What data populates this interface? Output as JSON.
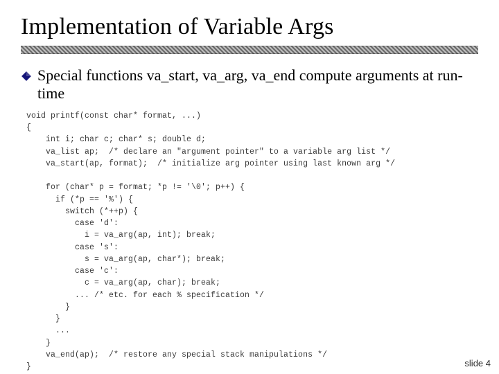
{
  "slide": {
    "title": "Implementation of Variable Args",
    "bullet": "Special functions va_start, va_arg, va_end compute arguments at run-time",
    "code": "void printf(const char* format, ...)\n{\n    int i; char c; char* s; double d;\n    va_list ap;  /* declare an \"argument pointer\" to a variable arg list */\n    va_start(ap, format);  /* initialize arg pointer using last known arg */\n\n    for (char* p = format; *p != '\\0'; p++) {\n      if (*p == '%') {\n        switch (*++p) {\n          case 'd':\n            i = va_arg(ap, int); break;\n          case 's':\n            s = va_arg(ap, char*); break;\n          case 'c':\n            c = va_arg(ap, char); break;\n          ... /* etc. for each % specification */\n        }\n      }\n      ...\n    }\n    va_end(ap);  /* restore any special stack manipulations */\n}",
    "footer": "slide 4"
  },
  "icons": {
    "bullet_diamond_color": "#151579"
  }
}
